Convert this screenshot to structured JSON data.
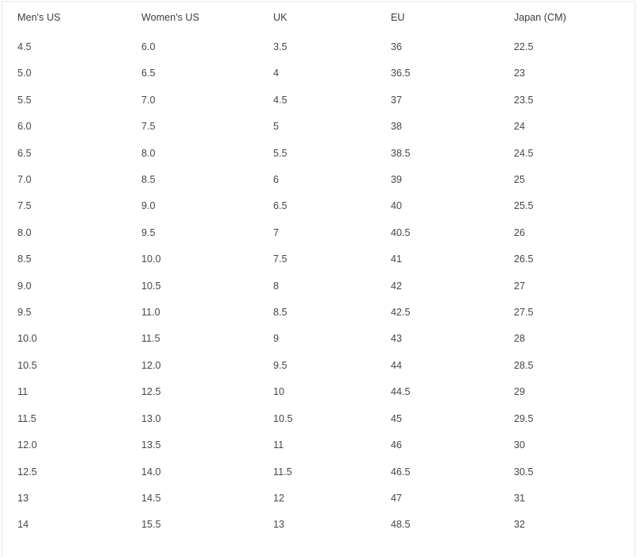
{
  "table": {
    "name": "shoe-size-conversion-table",
    "columns": [
      "Men's US",
      "Women's US",
      "UK",
      "EU",
      "Japan (CM)"
    ],
    "rows": [
      [
        "4.5",
        "6.0",
        "3.5",
        "36",
        "22.5"
      ],
      [
        "5.0",
        "6.5",
        "4",
        "36.5",
        "23"
      ],
      [
        "5.5",
        "7.0",
        "4.5",
        "37",
        "23.5"
      ],
      [
        "6.0",
        "7.5",
        "5",
        "38",
        "24"
      ],
      [
        "6.5",
        "8.0",
        "5.5",
        "38.5",
        "24.5"
      ],
      [
        "7.0",
        "8.5",
        "6",
        "39",
        "25"
      ],
      [
        "7.5",
        "9.0",
        "6.5",
        "40",
        "25.5"
      ],
      [
        "8.0",
        "9.5",
        "7",
        "40.5",
        "26"
      ],
      [
        "8.5",
        "10.0",
        "7.5",
        "41",
        "26.5"
      ],
      [
        "9.0",
        "10.5",
        "8",
        "42",
        "27"
      ],
      [
        "9.5",
        "11.0",
        "8.5",
        "42.5",
        "27.5"
      ],
      [
        "10.0",
        "11.5",
        "9",
        "43",
        "28"
      ],
      [
        "10.5",
        "12.0",
        "9.5",
        "44",
        "28.5"
      ],
      [
        "11",
        "12.5",
        "10",
        "44.5",
        "29"
      ],
      [
        "11.5",
        "13.0",
        "10.5",
        "45",
        "29.5"
      ],
      [
        "12.0",
        "13.5",
        "11",
        "46",
        "30"
      ],
      [
        "12.5",
        "14.0",
        "11.5",
        "46.5",
        "30.5"
      ],
      [
        "13",
        "14.5",
        "12",
        "47",
        "31"
      ],
      [
        "14",
        "15.5",
        "13",
        "48.5",
        "32"
      ]
    ]
  },
  "colors": {
    "background": "#ffffff",
    "border": "#e8e8e8",
    "header_text": "#3c3c3c",
    "body_text": "#44474c"
  }
}
